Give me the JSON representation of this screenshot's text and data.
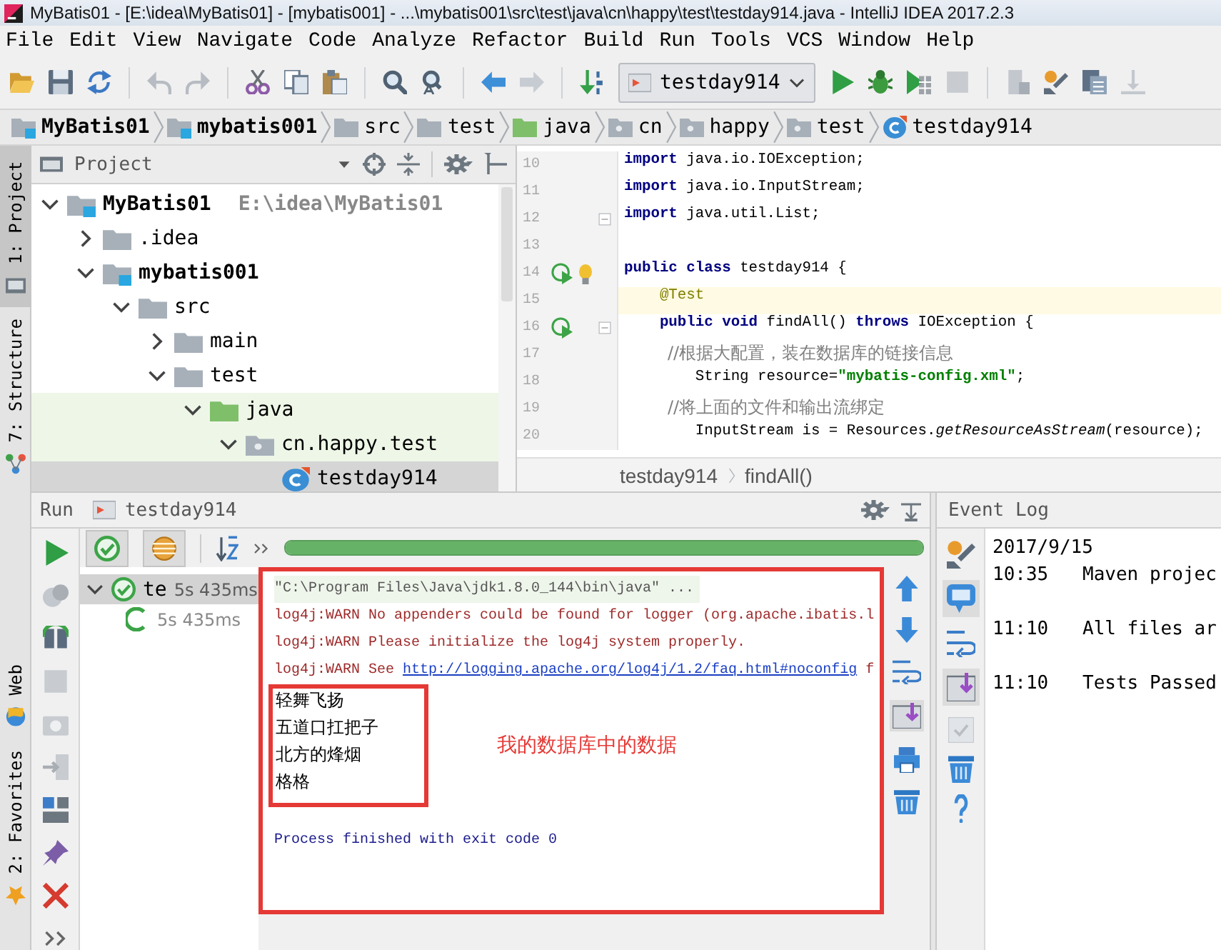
{
  "window": {
    "title": "MyBatis01 - [E:\\idea\\MyBatis01] - [mybatis001] - ...\\mybatis001\\src\\test\\java\\cn\\happy\\test\\testday914.java - IntelliJ IDEA 2017.2.3"
  },
  "menu": [
    "File",
    "Edit",
    "View",
    "Navigate",
    "Code",
    "Analyze",
    "Refactor",
    "Build",
    "Run",
    "Tools",
    "VCS",
    "Window",
    "Help"
  ],
  "toolbar": {
    "run_configuration": "testday914"
  },
  "breadcrumbs": [
    {
      "label": "MyBatis01",
      "kind": "module"
    },
    {
      "label": "mybatis001",
      "kind": "module"
    },
    {
      "label": "src",
      "kind": "folder"
    },
    {
      "label": "test",
      "kind": "folder"
    },
    {
      "label": "java",
      "kind": "test-root"
    },
    {
      "label": "cn",
      "kind": "package"
    },
    {
      "label": "happy",
      "kind": "package"
    },
    {
      "label": "test",
      "kind": "package"
    },
    {
      "label": "testday914",
      "kind": "class"
    }
  ],
  "side_tabs_top": [
    {
      "label": "1: Project",
      "kind": "project",
      "selected": true
    },
    {
      "label": "7: Structure",
      "kind": "structure",
      "selected": false
    }
  ],
  "side_tabs_bottom": [
    {
      "label": "Web",
      "kind": "web",
      "selected": false
    },
    {
      "label": "2: Favorites",
      "kind": "favorites",
      "selected": false
    }
  ],
  "project": {
    "title": "Project",
    "tree": [
      {
        "label": "MyBatis01",
        "path": "E:\\idea\\MyBatis01",
        "kind": "module",
        "expanded": true,
        "selected": false,
        "children": [
          {
            "label": ".idea",
            "kind": "folder",
            "expanded": false,
            "selected": false
          },
          {
            "label": "mybatis001",
            "kind": "module",
            "expanded": true,
            "selected": false,
            "children": [
              {
                "label": "src",
                "kind": "folder",
                "expanded": true,
                "selected": false,
                "children": [
                  {
                    "label": "main",
                    "kind": "folder",
                    "expanded": false,
                    "selected": false
                  },
                  {
                    "label": "test",
                    "kind": "folder",
                    "expanded": true,
                    "selected": false,
                    "children": [
                      {
                        "label": "java",
                        "kind": "test-root",
                        "expanded": true,
                        "selected": false,
                        "children": [
                          {
                            "label": "cn.happy.test",
                            "kind": "package",
                            "expanded": true,
                            "selected": false,
                            "children": [
                              {
                                "label": "testday914",
                                "kind": "class",
                                "selected": true
                              }
                            ]
                          }
                        ]
                      }
                    ]
                  }
                ]
              }
            ]
          }
        ]
      }
    ]
  },
  "editor": {
    "lines": [
      {
        "number": "10",
        "current": false,
        "run_marker": false,
        "fold": false,
        "bulb": false,
        "tokens": [
          {
            "text": "import",
            "kind": "keyword"
          },
          {
            "text": " java.io.IOException;",
            "kind": "plain"
          }
        ]
      },
      {
        "number": "11",
        "current": false,
        "run_marker": false,
        "fold": false,
        "bulb": false,
        "tokens": [
          {
            "text": "import",
            "kind": "keyword"
          },
          {
            "text": " java.io.InputStream;",
            "kind": "plain"
          }
        ]
      },
      {
        "number": "12",
        "current": false,
        "run_marker": false,
        "fold": true,
        "bulb": false,
        "tokens": [
          {
            "text": "import",
            "kind": "keyword"
          },
          {
            "text": " java.util.List;",
            "kind": "plain"
          }
        ]
      },
      {
        "number": "13",
        "current": false,
        "run_marker": false,
        "fold": false,
        "bulb": false
      },
      {
        "number": "14",
        "current": false,
        "run_marker": true,
        "fold": false,
        "bulb": true,
        "tokens": [
          {
            "text": "public class",
            "kind": "keyword"
          },
          {
            "text": " testday914 {",
            "kind": "plain"
          }
        ]
      },
      {
        "number": "15",
        "current": true,
        "run_marker": false,
        "fold": false,
        "bulb": false,
        "tokens": [
          {
            "text": "    @Test",
            "kind": "annotation"
          }
        ]
      },
      {
        "number": "16",
        "current": false,
        "run_marker": true,
        "fold": true,
        "bulb": false,
        "tokens": [
          {
            "text": "    public void",
            "kind": "keyword"
          },
          {
            "text": " findAll() ",
            "kind": "plain"
          },
          {
            "text": "throws",
            "kind": "keyword"
          },
          {
            "text": " IOException {",
            "kind": "plain"
          }
        ]
      },
      {
        "number": "17",
        "current": false,
        "run_marker": false,
        "fold": false,
        "bulb": false,
        "tokens": [
          {
            "text": "        //根据大配置，装在数据库的链接信息",
            "kind": "comment"
          }
        ]
      },
      {
        "number": "18",
        "current": false,
        "run_marker": false,
        "fold": false,
        "bulb": false,
        "tokens": [
          {
            "text": "        String resource=",
            "kind": "plain"
          },
          {
            "text": "\"mybatis-config.xml\"",
            "kind": "string"
          },
          {
            "text": ";",
            "kind": "plain"
          }
        ]
      },
      {
        "number": "19",
        "current": false,
        "run_marker": false,
        "fold": false,
        "bulb": false,
        "tokens": [
          {
            "text": "        //将上面的文件和输出流绑定",
            "kind": "comment"
          }
        ]
      },
      {
        "number": "20",
        "current": false,
        "run_marker": false,
        "fold": false,
        "bulb": false,
        "tokens": [
          {
            "text": "        InputStream is = Resources.",
            "kind": "plain"
          },
          {
            "text": "getResourceAsStream",
            "kind": "static"
          },
          {
            "text": "(resource);",
            "kind": "plain"
          }
        ]
      }
    ],
    "breadcrumbs": [
      "testday914",
      "findAll()"
    ]
  },
  "run": {
    "title": "Run",
    "tab": "testday914",
    "progress": {
      "level": 1
    },
    "tests": [
      {
        "label": "te",
        "duration": "5s 435ms",
        "kind": "passed",
        "expanded": true,
        "selected": true,
        "children": [
          {
            "duration": "5s 435ms",
            "kind": "pending",
            "selected": false
          }
        ]
      }
    ],
    "console": [
      {
        "kind": "command",
        "text": "\"C:\\Program Files\\Java\\jdk1.8.0_144\\bin\\java\" ..."
      },
      {
        "kind": "warn",
        "text": "log4j:WARN No appenders could be found for logger (org.apache.ibatis.l"
      },
      {
        "kind": "warn",
        "text": "log4j:WARN Please initialize the log4j system properly."
      },
      {
        "kind": "warn",
        "text": "log4j:WARN See ",
        "link": "http://logging.apache.org/log4j/1.2/faq.html#noconfig",
        "after": " f"
      },
      {
        "kind": "data",
        "text": "轻舞飞扬"
      },
      {
        "kind": "data",
        "text": "五道口扛把子"
      },
      {
        "kind": "data",
        "text": "北方的烽烟"
      },
      {
        "kind": "data",
        "text": "格格"
      },
      {
        "kind": "exit",
        "text": "Process finished with exit code 0"
      }
    ],
    "annotation": "我的数据库中的数据"
  },
  "event_log": {
    "title": "Event Log",
    "date": "2017/9/15",
    "entries": [
      {
        "time": "10:35",
        "text": "Maven projec"
      },
      {
        "time": "11:10",
        "text": "All files ar"
      },
      {
        "time": "11:10",
        "text": "Tests Passed"
      }
    ]
  }
}
